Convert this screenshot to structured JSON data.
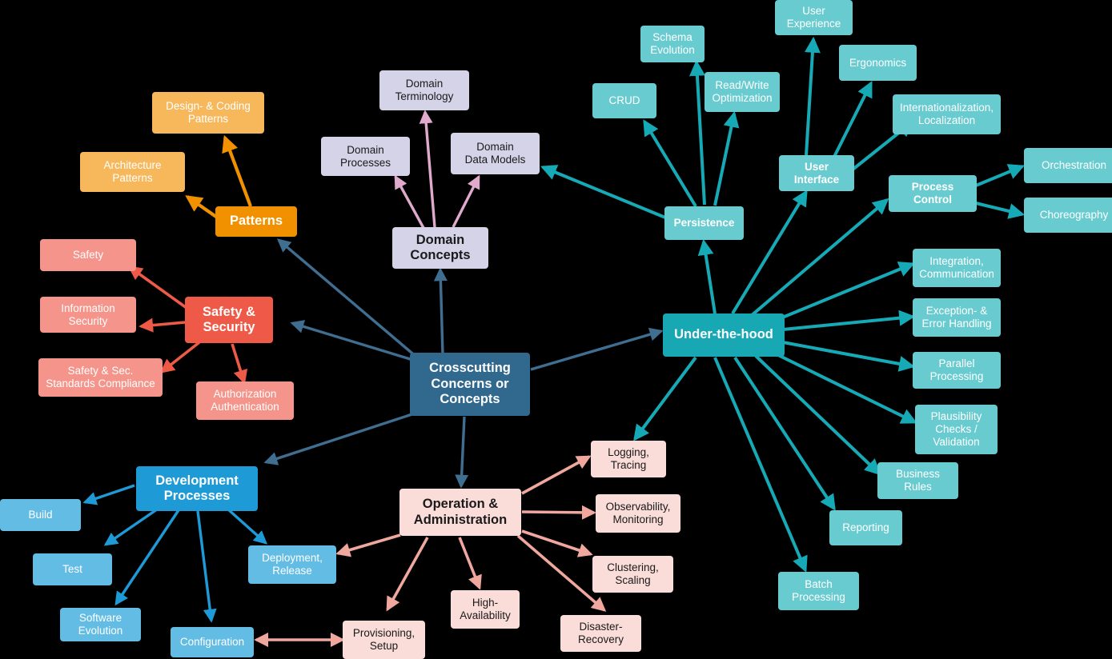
{
  "diagram": {
    "title": "Crosscutting Concerns or Concepts",
    "palette": {
      "background": "#000000",
      "center_hub": "#31688E",
      "center_edge": "#3F6E91",
      "orange_hub": "#F29100",
      "orange_child": "#F7B85C",
      "orange_edge": "#F29100",
      "red_hub": "#EE5A47",
      "red_child": "#F4948A",
      "red_edge": "#EE5A47",
      "purple_hub": "#D5D3E8",
      "purple_child": "#D5D3E8",
      "purple_edge": "#DFAACC",
      "teal_hub": "#17A8B4",
      "teal_child": "#68CBD0",
      "teal_edge": "#16AAB6",
      "blue_hub": "#1E9BD7",
      "blue_child": "#62BCE4",
      "blue_edge": "#1E9BD7",
      "pink_hub": "#FADCD9",
      "pink_child": "#FADCD9",
      "pink_edge": "#F0A79E",
      "text_light": "#FFFFFF",
      "text_dark": "#1A1A1A"
    },
    "nodes": {
      "center": "Crosscutting\nConcerns or\nConcepts",
      "patterns": "Patterns",
      "design_coding_patterns": "Design- & Coding\nPatterns",
      "architecture_patterns": "Architecture\nPatterns",
      "safety_security": "Safety &\nSecurity",
      "safety": "Safety",
      "information_security": "Information\nSecurity",
      "safety_sec_standards": "Safety & Sec.\nStandards Compliance",
      "authorization_authentication": "Authorization\nAuthentication",
      "domain_concepts": "Domain\nConcepts",
      "domain_terminology": "Domain\nTerminology",
      "domain_processes": "Domain\nProcesses",
      "domain_data_models": "Domain\nData Models",
      "under_the_hood": "Under-the-hood",
      "persistence": "Persistence",
      "crud": "CRUD",
      "schema_evolution": "Schema\nEvolution",
      "read_write_optimization": "Read/Write\nOptimization",
      "user_interface": "User\nInterface",
      "user_experience": "User\nExperience",
      "ergonomics": "Ergonomics",
      "internationalization": "Internationalization,\nLocalization",
      "process_control": "Process\nControl",
      "orchestration": "Orchestration",
      "choreography": "Choreography",
      "integration_communication": "Integration,\nCommunication",
      "exception_error_handling": "Exception- &\nError Handling",
      "parallel_processing": "Parallel\nProcessing",
      "plausibility_checks": "Plausibility\nChecks /\nValidation",
      "business_rules": "Business\nRules",
      "reporting": "Reporting",
      "batch_processing": "Batch\nProcessing",
      "development_processes": "Development\nProcesses",
      "build": "Build",
      "test": "Test",
      "software_evolution": "Software\nEvolution",
      "configuration": "Configuration",
      "deployment_release": "Deployment,\nRelease",
      "operation_administration": "Operation &\nAdministration",
      "logging_tracing": "Logging,\nTracing",
      "observability_monitoring": "Observability,\nMonitoring",
      "clustering_scaling": "Clustering,\nScaling",
      "disaster_recovery": "Disaster-\nRecovery",
      "high_availability": "High-\nAvailability",
      "provisioning_setup": "Provisioning,\nSetup"
    }
  }
}
